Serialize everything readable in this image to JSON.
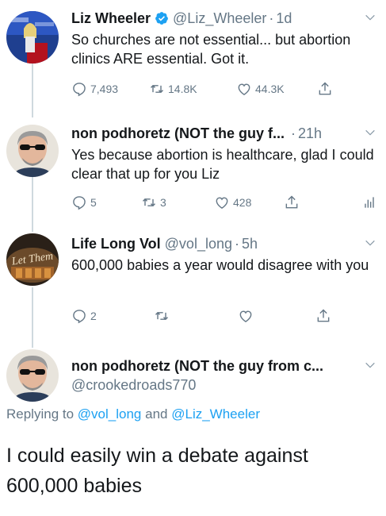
{
  "tweets": [
    {
      "name": "Liz Wheeler",
      "verified": true,
      "handle": "@Liz_Wheeler",
      "time": "1d",
      "text": "So churches are not essential... but abortion clinics ARE essential. Got it.",
      "replies": "7,493",
      "retweets": "14.8K",
      "likes": "44.3K"
    },
    {
      "name": "non podhoretz (NOT the guy f...",
      "time": "21h",
      "text": "Yes because abortion is healthcare, glad I could clear that up for you Liz",
      "replies": "5",
      "retweets": "3",
      "likes": "428"
    },
    {
      "name": "Life Long Vol",
      "handle": "@vol_long",
      "time": "5h",
      "text": "600,000 babies a year would disagree with you",
      "replies": "2",
      "avatar_text": "Let Them"
    }
  ],
  "focused": {
    "name": "non podhoretz (NOT the guy from c...",
    "handle": "@crookedroads770",
    "replying_prefix": "Replying to",
    "replying_to_1": "@vol_long",
    "replying_and": "and",
    "replying_to_2": "@Liz_Wheeler",
    "text": "I could easily win a debate against 600,000 babies"
  },
  "colors": {
    "verified": "#1da1f2",
    "muted": "#657786",
    "mention": "#1da1f2"
  },
  "icons": [
    "reply-icon",
    "retweet-icon",
    "like-icon",
    "share-icon",
    "analytics-icon",
    "chevron-down-icon",
    "verified-badge-icon"
  ]
}
